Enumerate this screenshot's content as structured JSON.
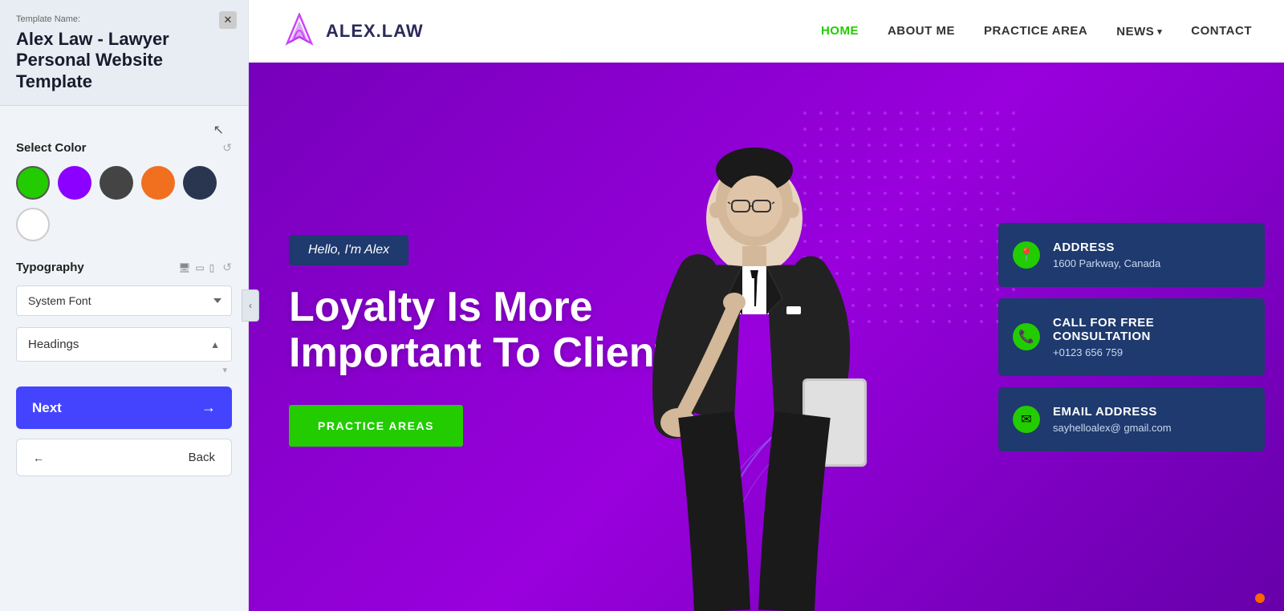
{
  "panel": {
    "template_name_label": "Template Name:",
    "template_name": "Alex Law - Lawyer Personal Website Template",
    "select_color_label": "Select Color",
    "colors": [
      {
        "name": "green",
        "class": "swatch-green",
        "active": true
      },
      {
        "name": "purple",
        "class": "swatch-purple",
        "active": false
      },
      {
        "name": "dark",
        "class": "swatch-dark",
        "active": false
      },
      {
        "name": "orange",
        "class": "swatch-orange",
        "active": false
      },
      {
        "name": "darkblue",
        "class": "swatch-darkblue",
        "active": false
      },
      {
        "name": "white",
        "class": "swatch-white",
        "active": false
      }
    ],
    "typography_label": "Typography",
    "font_select": "System Font",
    "headings_label": "Headings",
    "next_label": "Next",
    "back_label": "Back"
  },
  "navbar": {
    "logo_text": "ALEX.LAW",
    "links": [
      {
        "label": "HOME",
        "active": true
      },
      {
        "label": "ABOUT ME",
        "active": false
      },
      {
        "label": "PRACTICE AREA",
        "active": false
      },
      {
        "label": "NEWS",
        "active": false,
        "has_dropdown": true
      },
      {
        "label": "CONTACT",
        "active": false
      }
    ]
  },
  "hero": {
    "hello_badge": "Hello, I'm Alex",
    "title": "Loyalty Is More Important To Client",
    "cta_button": "PRACTICE AREAS"
  },
  "info_cards": [
    {
      "icon": "📍",
      "title": "ADDRESS",
      "value": "1600 Parkway, Canada",
      "icon_type": "location"
    },
    {
      "icon": "📞",
      "title": "CALL FOR FREE CONSULTATION",
      "value": "+0123 656 759",
      "icon_type": "phone"
    },
    {
      "icon": "✉",
      "title": "EMAIL ADDRESS",
      "value": "sayhelloalex@ gmail.com",
      "icon_type": "email"
    }
  ]
}
